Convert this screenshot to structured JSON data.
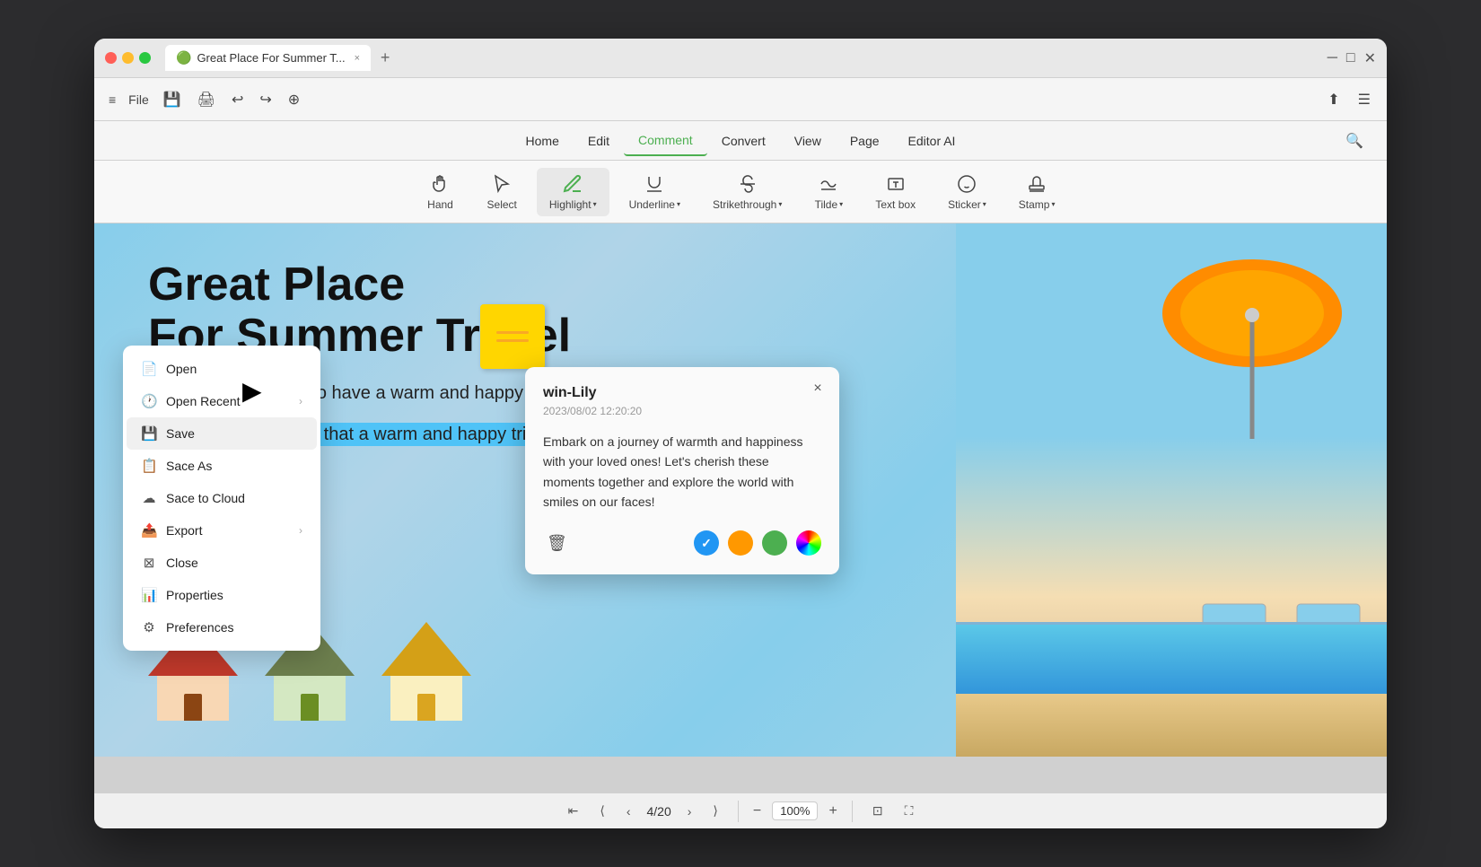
{
  "window": {
    "title": "Great Place For Summer T...",
    "tab_icon": "🟢"
  },
  "title_bar": {
    "tab_label": "Great Place For Summer T...",
    "tab_close": "×",
    "new_tab": "+",
    "controls": {
      "hamburger": "≡",
      "upload": "⬆",
      "menu": "☰"
    }
  },
  "toolbar": {
    "menu_label": "File",
    "icons": [
      "💾",
      "🖨",
      "↩",
      "↪",
      "⊕"
    ]
  },
  "menu_bar": {
    "items": [
      "Home",
      "Edit",
      "Comment",
      "Convert",
      "View",
      "Page",
      "Editor AI"
    ],
    "active_item": "Comment",
    "search_icon": "🔍"
  },
  "annotation_toolbar": {
    "items": [
      {
        "id": "hand",
        "icon": "✋",
        "label": "Hand",
        "has_dropdown": false
      },
      {
        "id": "select",
        "icon": "↖",
        "label": "Select",
        "has_dropdown": false
      },
      {
        "id": "highlight",
        "icon": "✏",
        "label": "Highlight",
        "has_dropdown": true,
        "active": true
      },
      {
        "id": "underline",
        "icon": "U̲",
        "label": "Underline",
        "has_dropdown": true
      },
      {
        "id": "strikethrough",
        "icon": "S̶",
        "label": "Strikethrough",
        "has_dropdown": true
      },
      {
        "id": "tilde",
        "icon": "~",
        "label": "Tilde",
        "has_dropdown": true
      },
      {
        "id": "textbox",
        "icon": "T",
        "label": "Text box",
        "has_dropdown": false
      },
      {
        "id": "sticker",
        "icon": "☺",
        "label": "Sticker",
        "has_dropdown": true
      },
      {
        "id": "stamp",
        "icon": "⊕",
        "label": "Stamp",
        "has_dropdown": true
      }
    ]
  },
  "pdf": {
    "title_line1": "Great Place",
    "title_line2": "For Summer Travel",
    "body1": "It is quite necessary to have a warm and happy trip with your family.",
    "body2_highlighted": "Scientists have found that a warm and happy trip can help a happy family.",
    "page_current": 4,
    "page_total": 20,
    "zoom": "100%"
  },
  "comment_popup": {
    "author": "win-Lily",
    "date": "2023/08/02 12:20:20",
    "body": "Embark on a journey of warmth and happiness with your loved ones! Let's cherish these moments together and explore the world with smiles on our faces!",
    "close_btn": "×",
    "colors": [
      {
        "id": "blue",
        "hex": "#2196F3",
        "selected": true
      },
      {
        "id": "orange",
        "hex": "#FF9800",
        "selected": false
      },
      {
        "id": "green",
        "hex": "#4CAF50",
        "selected": false
      },
      {
        "id": "rainbow",
        "hex": "rainbow",
        "selected": false
      }
    ]
  },
  "file_menu": {
    "items": [
      {
        "id": "open",
        "icon": "📄",
        "label": "Open",
        "has_arrow": false
      },
      {
        "id": "open-recent",
        "icon": "🕐",
        "label": "Open Recent",
        "has_arrow": true
      },
      {
        "id": "save",
        "icon": "💾",
        "label": "Save",
        "has_arrow": false,
        "highlighted": true
      },
      {
        "id": "save-as",
        "icon": "📋",
        "label": "Sace As",
        "has_arrow": false
      },
      {
        "id": "save-cloud",
        "icon": "☁",
        "label": "Sace to Cloud",
        "has_arrow": false
      },
      {
        "id": "export",
        "icon": "📤",
        "label": "Export",
        "has_arrow": true
      },
      {
        "id": "close",
        "icon": "⊠",
        "label": "Close",
        "has_arrow": false
      },
      {
        "id": "properties",
        "icon": "📊",
        "label": "Properties",
        "has_arrow": false
      },
      {
        "id": "preferences",
        "icon": "⚙",
        "label": "Preferences",
        "has_arrow": false
      }
    ]
  },
  "bottom_bar": {
    "nav_first": "⇤",
    "nav_prev_skip": "⟨",
    "nav_prev": "‹",
    "page_label": "4/20",
    "nav_next": "›",
    "nav_last": "⟩",
    "zoom_out": "−",
    "zoom_level": "100%",
    "zoom_in": "+",
    "fit_page": "⊡",
    "full_screen": "⛶"
  }
}
